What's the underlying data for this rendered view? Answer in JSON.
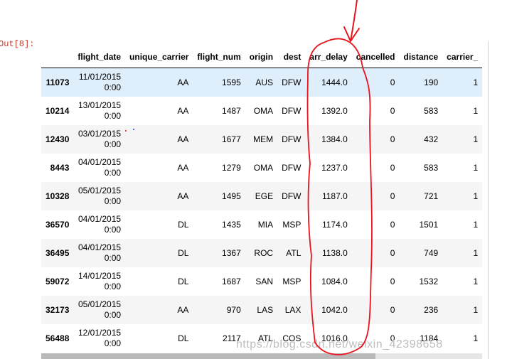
{
  "cell": {
    "prompt": "Out[8]:"
  },
  "table": {
    "columns": [
      "",
      "flight_date",
      "unique_carrier",
      "flight_num",
      "origin",
      "dest",
      "arr_delay",
      "cancelled",
      "distance",
      "carrier_"
    ],
    "rows": [
      [
        "11073",
        "11/01/2015",
        "0:00",
        "AA",
        "1595",
        "AUS",
        "DFW",
        "1444.0",
        "0",
        "190",
        "1"
      ],
      [
        "10214",
        "13/01/2015",
        "0:00",
        "AA",
        "1487",
        "OMA",
        "DFW",
        "1392.0",
        "0",
        "583",
        "1"
      ],
      [
        "12430",
        "03/01/2015",
        "0:00",
        "AA",
        "1677",
        "MEM",
        "DFW",
        "1384.0",
        "0",
        "432",
        "1"
      ],
      [
        "8443",
        "04/01/2015",
        "0:00",
        "AA",
        "1279",
        "OMA",
        "DFW",
        "1237.0",
        "0",
        "583",
        "1"
      ],
      [
        "10328",
        "05/01/2015",
        "0:00",
        "AA",
        "1495",
        "EGE",
        "DFW",
        "1187.0",
        "0",
        "721",
        "1"
      ],
      [
        "36570",
        "04/01/2015",
        "0:00",
        "DL",
        "1435",
        "MIA",
        "MSP",
        "1174.0",
        "0",
        "1501",
        "1"
      ],
      [
        "36495",
        "04/01/2015",
        "0:00",
        "DL",
        "1367",
        "ROC",
        "ATL",
        "1138.0",
        "0",
        "749",
        "1"
      ],
      [
        "59072",
        "14/01/2015",
        "0:00",
        "DL",
        "1687",
        "SAN",
        "MSP",
        "1084.0",
        "0",
        "1532",
        "1"
      ],
      [
        "32173",
        "05/01/2015",
        "0:00",
        "AA",
        "970",
        "LAS",
        "LAX",
        "1042.0",
        "0",
        "236",
        "1"
      ],
      [
        "56488",
        "12/01/2015",
        "0:00",
        "DL",
        "2117",
        "ATL",
        "COS",
        "1016.0",
        "0",
        "1184",
        "1"
      ]
    ]
  },
  "watermark": "https://blog.csdn.net/weixin_42398658",
  "colors": {
    "highlight_row": "#dfeefb",
    "annotation": "#e8141c",
    "prompt": "#c0392b"
  }
}
